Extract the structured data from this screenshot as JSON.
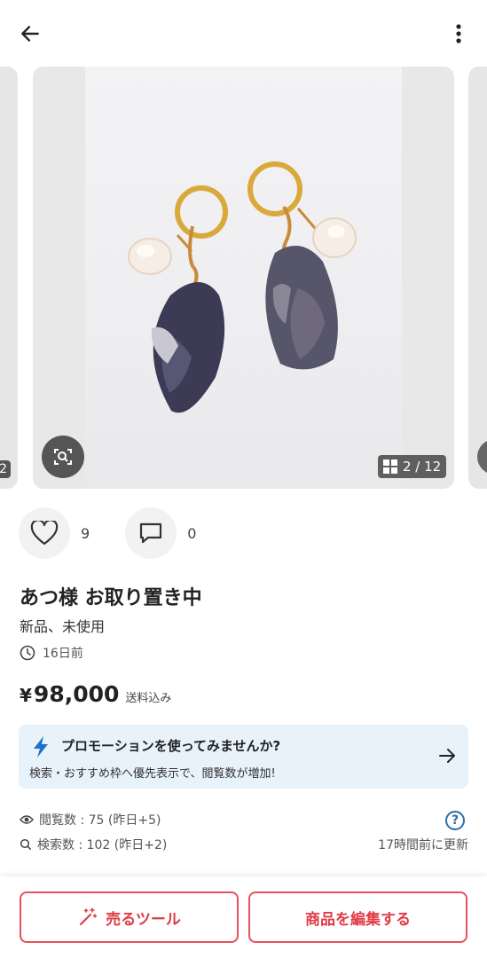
{
  "header": {
    "back_icon": "arrow-left-icon",
    "menu_icon": "more-vertical-icon"
  },
  "gallery": {
    "prev_slide_number": "2",
    "counter": "2 / 12",
    "lens_icon": "image-search-icon",
    "grid_icon": "grid-icon"
  },
  "engagement": {
    "likes": "9",
    "comments": "0"
  },
  "item": {
    "title": "あつ様 お取り置き中",
    "condition": "新品、未使用",
    "posted": "16日前",
    "price_symbol": "¥",
    "price": "98,000",
    "shipping": "送料込み"
  },
  "promo": {
    "title": "プロモーションを使ってみませんか?",
    "description": "検索・おすすめ枠へ優先表示で、閲覧数が増加!"
  },
  "stats": {
    "views": "閲覧数 : 75 (昨日+5)",
    "searches": "検索数 : 102 (昨日+2)",
    "updated": "17時間前に更新"
  },
  "buttons": {
    "sell_tool": "売るツール",
    "edit_item": "商品を編集する"
  },
  "colors": {
    "accent": "#e03c48",
    "promo_bg": "#e8f2fb",
    "bolt": "#1a73c8"
  }
}
